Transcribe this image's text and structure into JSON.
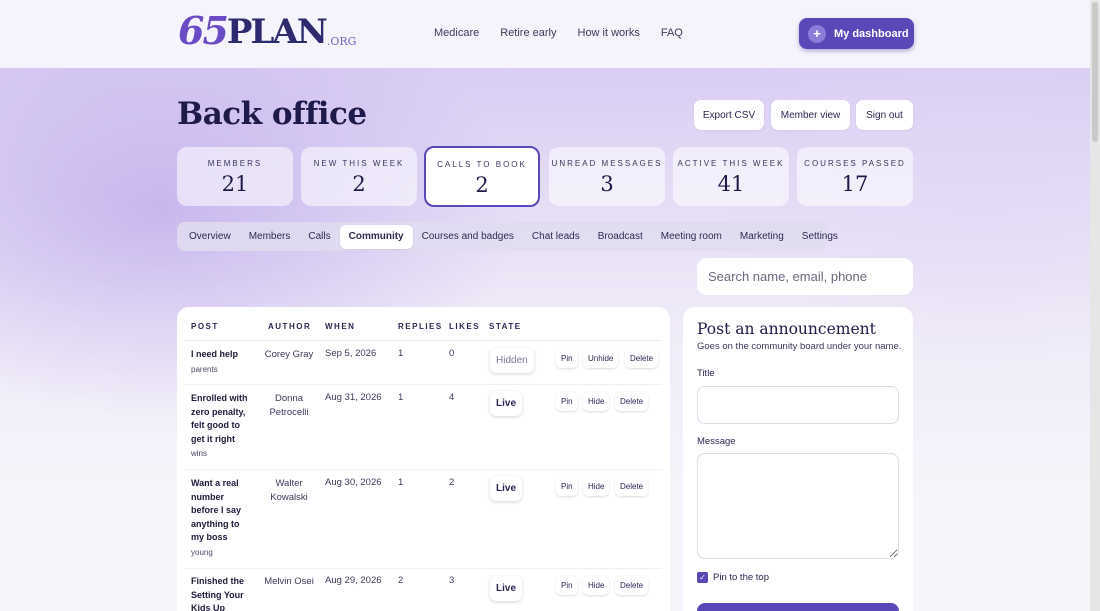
{
  "brand": {
    "logo_num": "65",
    "logo_word": "PLAN",
    "logo_tld": ".ORG"
  },
  "nav": [
    "Medicare",
    "Retire early",
    "How it works",
    "FAQ"
  ],
  "header_button": {
    "label": "My dashboard",
    "icon": "plus-icon"
  },
  "page_title": "Back office",
  "header_actions": {
    "export": "Export CSV",
    "member_view": "Member view",
    "sign_out": "Sign out"
  },
  "stats": [
    {
      "label": "Members",
      "value": "21"
    },
    {
      "label": "New this week",
      "value": "2"
    },
    {
      "label": "Calls to book",
      "value": "2",
      "active": true
    },
    {
      "label": "Unread messages",
      "value": "3"
    },
    {
      "label": "Active this week",
      "value": "41"
    },
    {
      "label": "Courses passed",
      "value": "17"
    }
  ],
  "tabs": [
    "Overview",
    "Members",
    "Calls",
    "Community",
    "Courses and badges",
    "Chat leads",
    "Broadcast",
    "Meeting room",
    "Marketing",
    "Settings"
  ],
  "active_tab": "Community",
  "search": {
    "placeholder": "Search name, email, phone"
  },
  "table": {
    "headers": [
      "Post",
      "Author",
      "When",
      "Replies",
      "Likes",
      "State"
    ],
    "rows": [
      {
        "title": "I need help",
        "tag": "parents",
        "author": "Corey Gray",
        "when": "Sep 5, 2026",
        "replies": "1",
        "likes": "0",
        "state": "Hidden",
        "actions": [
          "Pin",
          "Unhide",
          "Delete"
        ]
      },
      {
        "title": "Enrolled with zero penalty, felt good to get it right",
        "tag": "wins",
        "author": "Donna Petrocelli",
        "when": "Aug 31, 2026",
        "replies": "1",
        "likes": "4",
        "state": "Live",
        "actions": [
          "Pin",
          "Hide",
          "Delete"
        ]
      },
      {
        "title": "Want a real number before I say anything to my boss",
        "tag": "young",
        "author": "Walter Kowalski",
        "when": "Aug 30, 2026",
        "replies": "1",
        "likes": "2",
        "state": "Live",
        "actions": [
          "Pin",
          "Hide",
          "Delete"
        ]
      },
      {
        "title": "Finished the Setting Your Kids Up",
        "tag": "",
        "author": "Melvin Osei",
        "when": "Aug 29, 2026",
        "replies": "2",
        "likes": "3",
        "state": "Live",
        "actions": [
          "Pin",
          "Hide",
          "Delete"
        ]
      }
    ]
  },
  "announcement": {
    "title": "Post an announcement",
    "subtitle": "Goes on the community board under your name.",
    "title_label": "Title",
    "title_value": "",
    "message_label": "Message",
    "message_value": "",
    "pin_label": "Pin to the top",
    "pin_checked": true
  },
  "colors": {
    "accent": "#5a47b8",
    "logo_purple": "#6b4bc4",
    "navy": "#1e1b4b"
  }
}
